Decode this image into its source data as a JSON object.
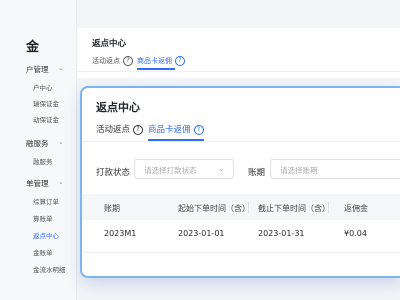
{
  "background_app": {
    "logo": "金",
    "page_title": "返点中心",
    "tabs": [
      {
        "label": "活动返点"
      },
      {
        "label": "商品卡返佣"
      }
    ],
    "sidebar_groups": [
      {
        "label": "户管理",
        "items": [
          "户中心",
          "瑞保证金",
          "动保证金"
        ]
      },
      {
        "label": "融服务",
        "items": [
          "融服务"
        ]
      },
      {
        "label": "单管理",
        "items": [
          "综算订单",
          "算账单",
          "返点中心",
          "金账单",
          "金流水明细"
        ]
      }
    ]
  },
  "card": {
    "title": "返点中心",
    "tabs": [
      {
        "label": "活动返点"
      },
      {
        "label": "商品卡返佣"
      }
    ],
    "filters": {
      "status_label": "打款状态",
      "status_placeholder": "请选择打款状态",
      "period_label": "账期",
      "period_placeholder": "请选择账期"
    },
    "table": {
      "columns": [
        "账期",
        "起始下单时间（含）",
        "截止下单时间（含）",
        "返佣金"
      ],
      "rows": [
        [
          "2023M1",
          "2023-01-01",
          "2023-01-31",
          "¥0.04"
        ]
      ]
    }
  },
  "colors": {
    "accent": "#2f6df6",
    "card_border": "#7db4ef"
  }
}
